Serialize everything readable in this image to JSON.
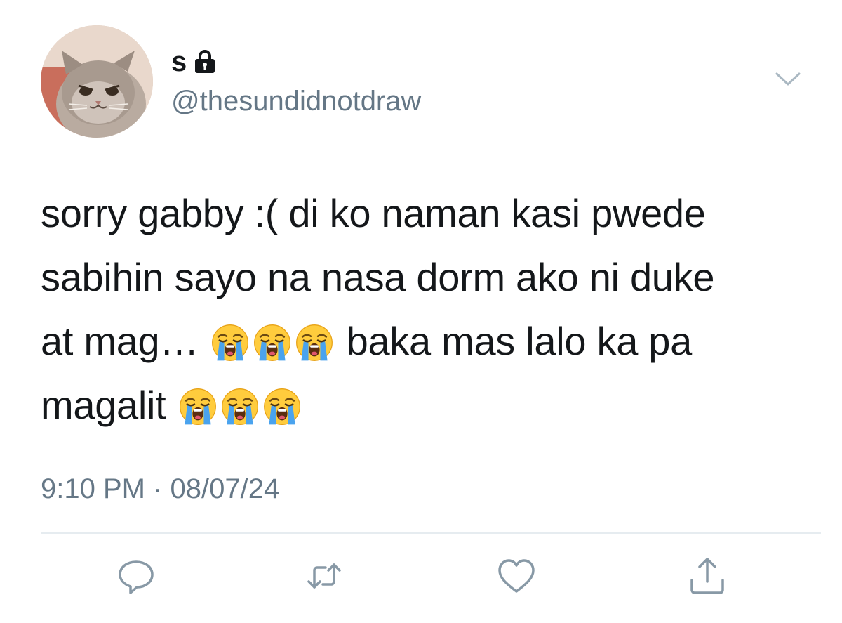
{
  "user": {
    "display_name": "s",
    "handle": "@thesundidnotdraw",
    "protected_icon": "lock-icon",
    "avatar": "cat-avatar"
  },
  "tweet": {
    "lines": [
      {
        "text": "sorry gabby :( di ko naman kasi pwede"
      },
      {
        "text": "sabihin sayo na nasa dorm ako ni duke"
      },
      {
        "pre": "at mag… ",
        "post": " baka mas lalo ka pa"
      },
      {
        "pre": "magalit "
      }
    ],
    "emoji_name": "loudly-crying-face-emoji",
    "timestamp": "9:10 PM · 08/07/24"
  },
  "menu": {
    "icon": "chevron-down-icon"
  },
  "actions": [
    {
      "name": "reply",
      "icon": "reply-icon"
    },
    {
      "name": "retweet",
      "icon": "retweet-icon"
    },
    {
      "name": "like",
      "icon": "heart-icon"
    },
    {
      "name": "share",
      "icon": "share-icon"
    }
  ],
  "colors": {
    "text": "#14171a",
    "secondary": "#657786",
    "icon": "#8899a6",
    "divider": "#e6ecf0"
  }
}
